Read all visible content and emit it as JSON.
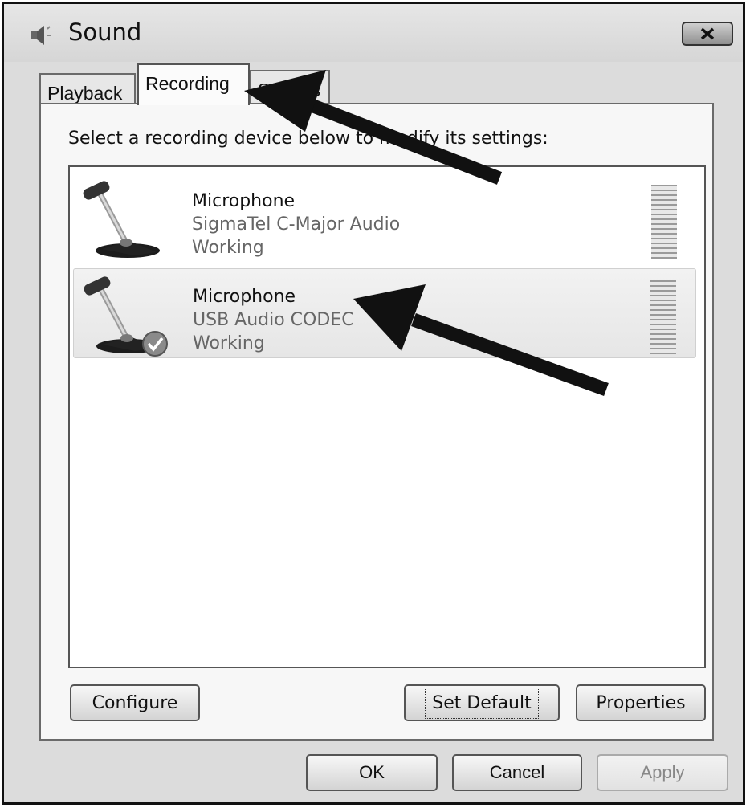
{
  "window": {
    "title": "Sound",
    "title_icon": "speaker-icon",
    "close_icon": "close-icon"
  },
  "tabs": [
    {
      "label": "Playback",
      "active": false
    },
    {
      "label": "Recording",
      "active": true
    },
    {
      "label": "Sounds",
      "active": false
    }
  ],
  "instruction": "Select a recording device below to modify its settings:",
  "devices": [
    {
      "name": "Microphone",
      "description": "SigmaTel C-Major Audio",
      "status": "Working",
      "icon": "microphone-icon",
      "default": false
    },
    {
      "name": "Microphone",
      "description": "USB Audio CODEC",
      "status": "Working",
      "icon": "microphone-icon",
      "default": true,
      "badge_icon": "default-check-icon"
    }
  ],
  "buttons": {
    "configure": "Configure",
    "set_default": "Set Default",
    "properties": "Properties",
    "ok": "OK",
    "cancel": "Cancel",
    "apply": "Apply"
  },
  "annotations": {
    "arrow_color": "#111111"
  }
}
